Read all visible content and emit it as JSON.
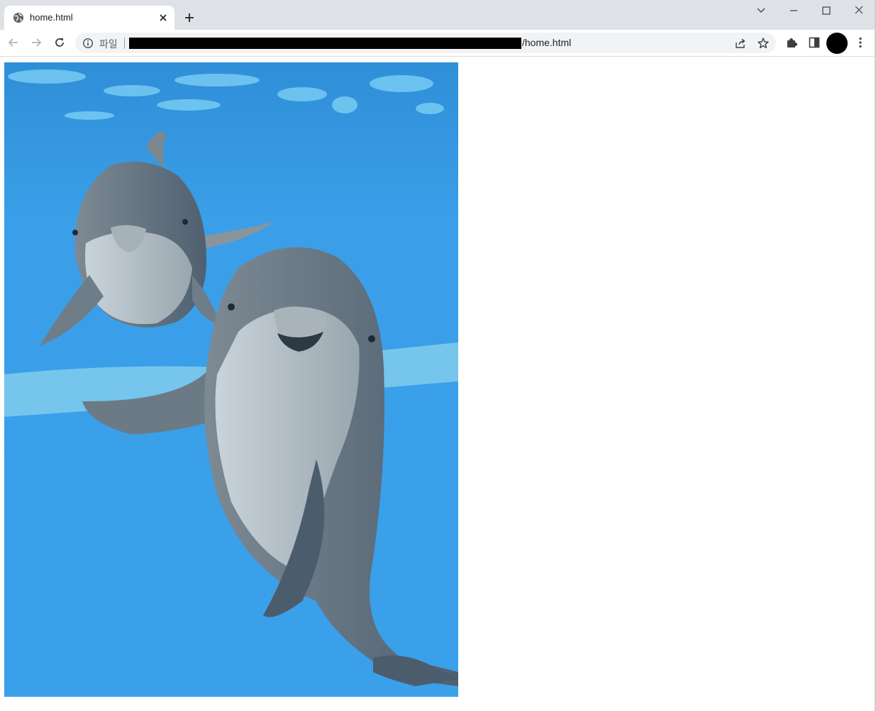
{
  "browser": {
    "tab": {
      "title": "home.html"
    },
    "address_bar": {
      "scheme_label": "파일",
      "url_suffix": "/home.html"
    }
  },
  "icons": {
    "favicon": "globe-icon",
    "tab_close": "close-icon",
    "new_tab": "plus-icon",
    "tab_search": "chevron-down-icon",
    "minimize": "minimize-icon",
    "maximize": "maximize-icon",
    "close_window": "close-icon",
    "back": "arrow-left-icon",
    "forward": "arrow-right-icon",
    "reload": "reload-icon",
    "site_info": "info-icon",
    "share": "share-icon",
    "bookmark": "star-icon",
    "extensions": "puzzle-icon",
    "side_panel": "side-panel-icon",
    "menu": "kebab-menu-icon"
  },
  "colors": {
    "tabstrip_bg": "#dee1e6",
    "omnibox_bg": "#f1f3f4",
    "water_blue": "#3b9fe6",
    "dolphin_gray": "#8a949c"
  }
}
